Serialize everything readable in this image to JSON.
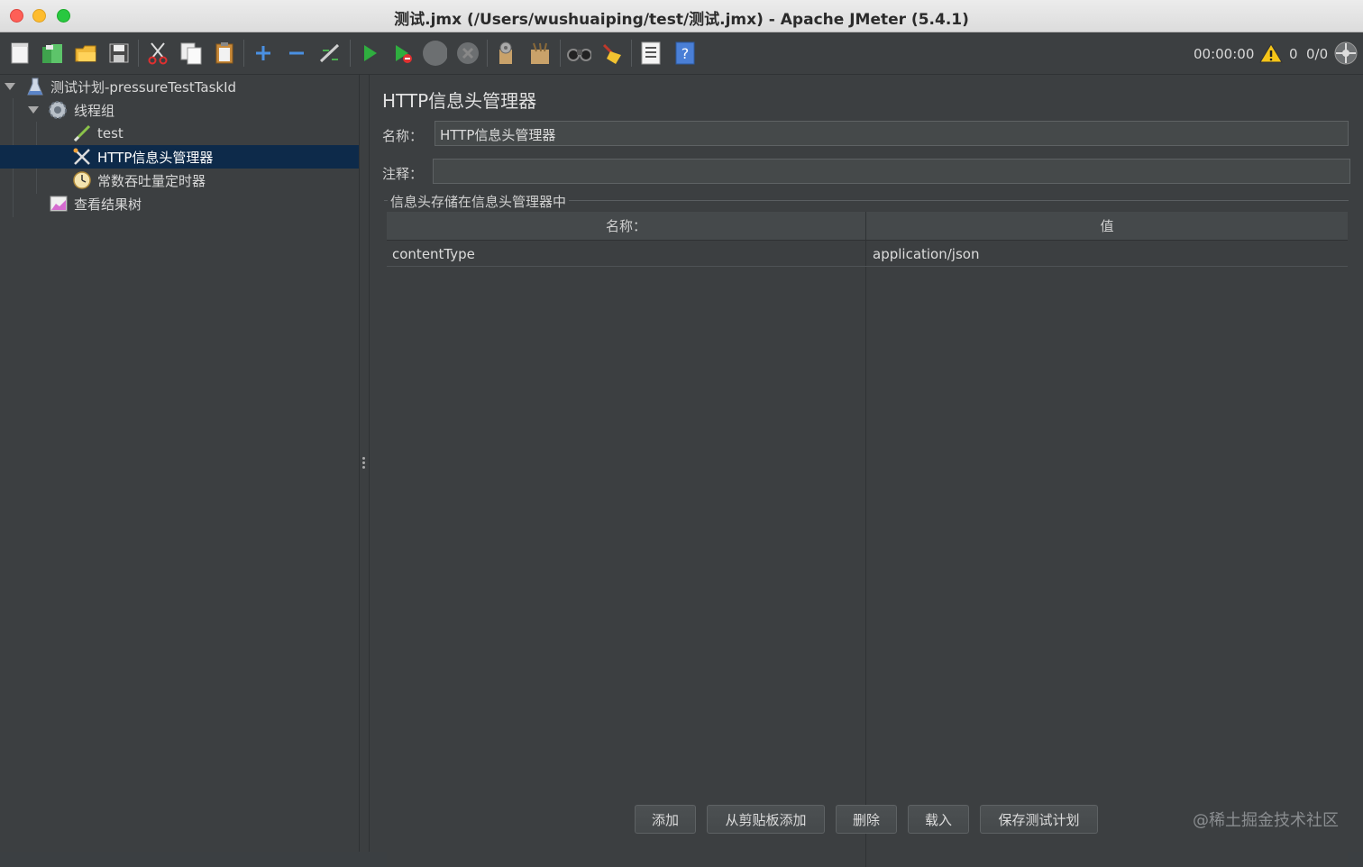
{
  "window": {
    "title": "测试.jmx (/Users/wushuaiping/test/测试.jmx) - Apache JMeter (5.4.1)"
  },
  "toolbar": {
    "icons": [
      "new-icon",
      "templates-icon",
      "open-icon",
      "save-icon",
      "cut-icon",
      "copy-icon",
      "paste-icon",
      "expand-icon",
      "collapse-icon",
      "toggle-icon",
      "start-icon",
      "start-no-pauses-icon",
      "stop-icon",
      "shutdown-icon",
      "clear-icon",
      "clear-all-icon",
      "search-icon",
      "reset-search-icon",
      "function-helper-icon",
      "help-icon"
    ],
    "timer": "00:00:00",
    "warning_count": "0",
    "threads": "0/0"
  },
  "tree": {
    "items": [
      {
        "label": "测试计划-pressureTestTaskId",
        "icon": "test-plan-icon"
      },
      {
        "label": "线程组",
        "icon": "thread-group-icon"
      },
      {
        "label": "test",
        "icon": "sampler-icon"
      },
      {
        "label": "HTTP信息头管理器",
        "icon": "header-manager-icon",
        "selected": true
      },
      {
        "label": "常数吞吐量定时器",
        "icon": "timer-icon"
      },
      {
        "label": "查看结果树",
        "icon": "results-tree-icon"
      }
    ]
  },
  "panel": {
    "title": "HTTP信息头管理器",
    "name_label": "名称：",
    "name_value": "HTTP信息头管理器",
    "comment_label": "注释：",
    "comment_value": "",
    "group_title": "信息头存储在信息头管理器中",
    "table": {
      "headers": [
        "名称：",
        "值"
      ],
      "rows": [
        [
          "contentType",
          "application/json"
        ]
      ]
    },
    "buttons": {
      "add": "添加",
      "add_clipboard": "从剪贴板添加",
      "delete": "删除",
      "load": "载入",
      "save_plan": "保存测试计划"
    }
  },
  "watermark": "@稀土掘金技术社区"
}
